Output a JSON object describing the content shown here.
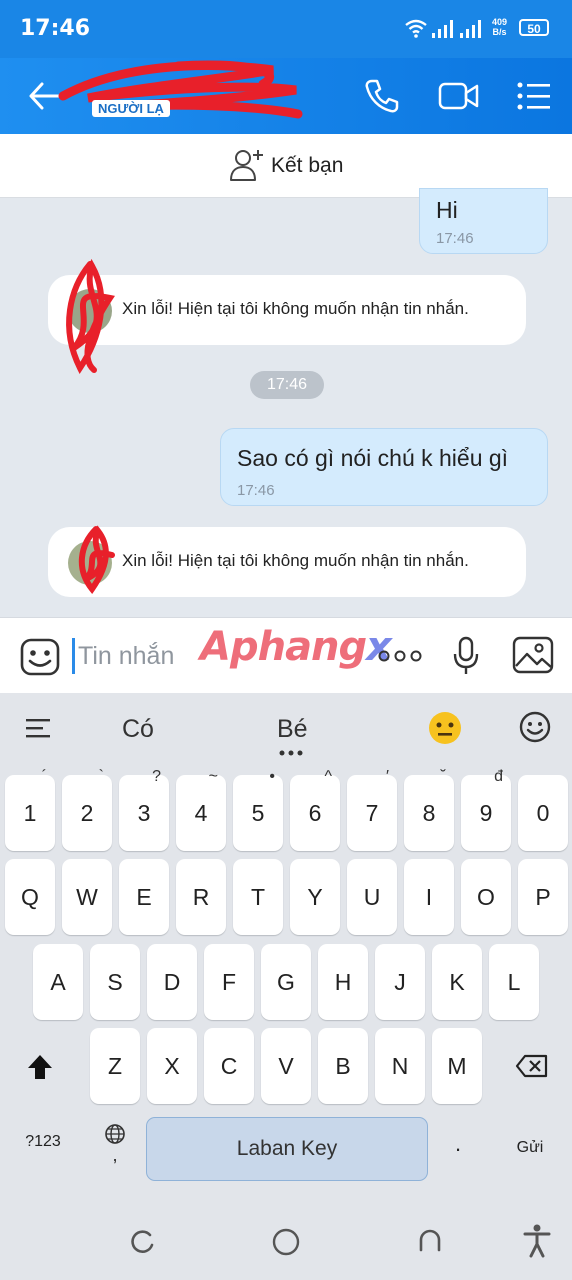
{
  "status_bar": {
    "time": "17:46",
    "net_speed_value": "409",
    "net_speed_unit": "B/s",
    "battery": "50"
  },
  "header": {
    "stranger_badge": "NGƯỜI LẠ"
  },
  "add_friend": {
    "label": "Kết bạn"
  },
  "messages": {
    "out1": {
      "text": "Hi",
      "time": "17:46"
    },
    "sys1": {
      "text": "Xin lỗi! Hiện tại tôi không muốn nhận tin nhắn."
    },
    "time_divider": "17:46",
    "out2": {
      "text": "Sao có gì nói chú k hiểu gì",
      "time": "17:46"
    },
    "sys2": {
      "text": "Xin lỗi! Hiện tại tôi không muốn nhận tin nhắn."
    }
  },
  "composer": {
    "placeholder": "Tin nhắn",
    "watermark_a": "Aphang",
    "watermark_b": "x"
  },
  "keyboard": {
    "suggestions": [
      "Có",
      "Bé"
    ],
    "number_row": [
      "1",
      "2",
      "3",
      "4",
      "5",
      "6",
      "7",
      "8",
      "9",
      "0"
    ],
    "number_hints": [
      "´",
      "`",
      "?",
      "~",
      "•",
      "^",
      "′",
      "˘",
      "đ",
      ""
    ],
    "row_q": [
      "Q",
      "W",
      "E",
      "R",
      "T",
      "Y",
      "U",
      "I",
      "O",
      "P"
    ],
    "row_a": [
      "A",
      "S",
      "D",
      "F",
      "G",
      "H",
      "J",
      "K",
      "L"
    ],
    "row_z": [
      "Z",
      "X",
      "C",
      "V",
      "B",
      "N",
      "M"
    ],
    "sym_key": "?123",
    "comma_key": ",",
    "space_label": "Laban Key",
    "period_key": ".",
    "send_key": "Gửi"
  },
  "colors": {
    "header_blue": "#1a86e6",
    "bubble_out": "#d4ebfd",
    "scribble_red": "#e8202a"
  }
}
